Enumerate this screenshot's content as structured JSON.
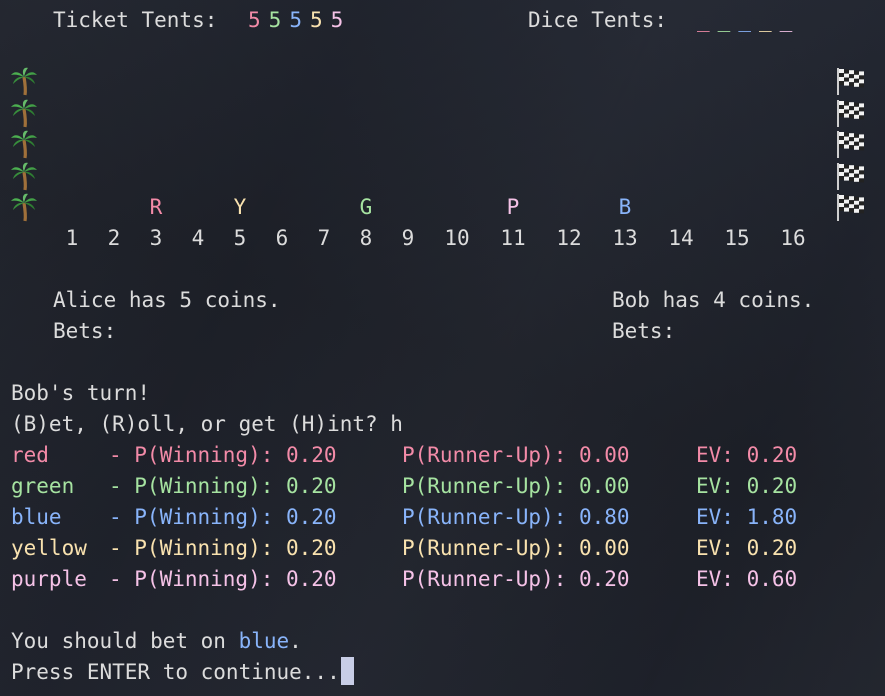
{
  "header": {
    "ticket_label": "Ticket Tents:",
    "ticket_tents": [
      {
        "value": "5",
        "color": "red"
      },
      {
        "value": "5",
        "color": "green"
      },
      {
        "value": "5",
        "color": "blue"
      },
      {
        "value": "5",
        "color": "yellow"
      },
      {
        "value": "5",
        "color": "purple"
      }
    ],
    "dice_label": "Dice Tents:",
    "dice_tents": [
      {
        "value": "_",
        "color": "red"
      },
      {
        "value": "_",
        "color": "green"
      },
      {
        "value": "_",
        "color": "blue"
      },
      {
        "value": "_",
        "color": "yellow"
      },
      {
        "value": "_",
        "color": "purple"
      }
    ]
  },
  "track": {
    "start_icon": "palm-tree-icon",
    "finish_icon": "checkered-flag-icon",
    "lanes": 5,
    "runners": [
      {
        "letter": "R",
        "color": "red",
        "position": 3
      },
      {
        "letter": "Y",
        "color": "yellow",
        "position": 5
      },
      {
        "letter": "G",
        "color": "green",
        "position": 8
      },
      {
        "letter": "P",
        "color": "purple",
        "position": 11
      },
      {
        "letter": "B",
        "color": "blue",
        "position": 13
      }
    ],
    "numbers": [
      "1",
      "2",
      "3",
      "4",
      "5",
      "6",
      "7",
      "8",
      "9",
      "10",
      "11",
      "12",
      "13",
      "14",
      "15",
      "16"
    ]
  },
  "players": [
    {
      "status": "Alice has 5 coins.",
      "bets_label": "Bets:"
    },
    {
      "status": "Bob has 4 coins.",
      "bets_label": "Bets:"
    }
  ],
  "console": {
    "turn": "Bob's turn!",
    "prompt": "(B)et, (R)oll, or get (H)int? h",
    "hints": [
      {
        "name": "red   ",
        "color": "red",
        "p_win": "- P(Winning): 0.20",
        "p_runner": "P(Runner-Up): 0.00",
        "ev": "EV: 0.20"
      },
      {
        "name": "green ",
        "color": "green",
        "p_win": "- P(Winning): 0.20",
        "p_runner": "P(Runner-Up): 0.00",
        "ev": "EV: 0.20"
      },
      {
        "name": "blue  ",
        "color": "blue",
        "p_win": "- P(Winning): 0.20",
        "p_runner": "P(Runner-Up): 0.80",
        "ev": "EV: 1.80"
      },
      {
        "name": "yellow",
        "color": "yellow",
        "p_win": "- P(Winning): 0.20",
        "p_runner": "P(Runner-Up): 0.00",
        "ev": "EV: 0.20"
      },
      {
        "name": "purple",
        "color": "purple",
        "p_win": "- P(Winning): 0.20",
        "p_runner": "P(Runner-Up): 0.20",
        "ev": "EV: 0.60"
      }
    ],
    "suggestion_prefix": "You should bet on ",
    "suggestion_color": "blue",
    "suggestion_value": "blue",
    "suggestion_suffix": ".",
    "continue_prompt": "Press ENTER to continue..."
  },
  "colors": {
    "red": "#f38ba8",
    "green": "#a6e3a1",
    "blue": "#89b4fa",
    "yellow": "#f9e2af",
    "purple": "#f5c2e7",
    "text": "#dcdcdc",
    "background": "#1e2129"
  }
}
